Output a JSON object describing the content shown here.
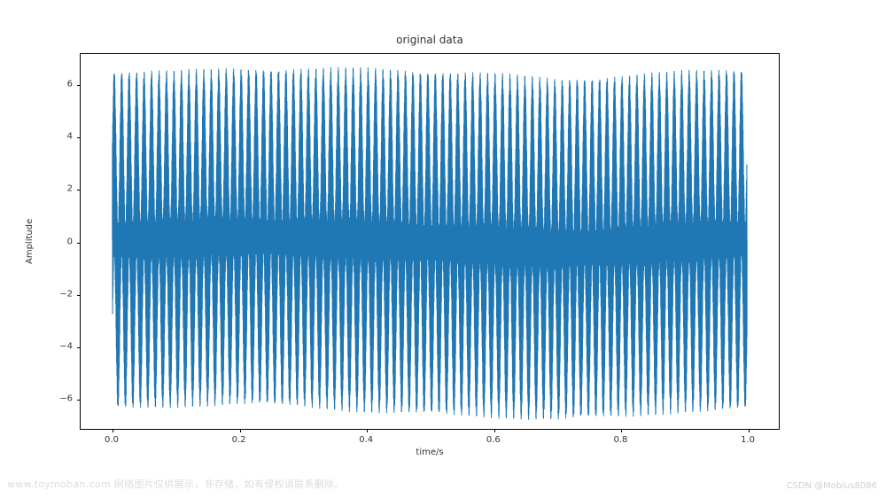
{
  "chart_data": {
    "type": "line",
    "title": "original data",
    "xlabel": "time/s",
    "ylabel": "Amplitude",
    "xticks": [
      0.0,
      0.2,
      0.4,
      0.6,
      0.8,
      1.0
    ],
    "yticks": [
      -6,
      -4,
      -2,
      0,
      2,
      4,
      6
    ],
    "xlim": [
      -0.05,
      1.05
    ],
    "ylim": [
      -7.2,
      7.2
    ],
    "signal": {
      "description": "Densely oscillating multi-frequency waveform filling x ∈ [0,1], positive envelope modulated between about 6.2 and 6.8, negative envelope mirrored between about -6.2 and -6.8. Envelope undulates slowly (≈2 cycles over the interval) with a visible bulge near x≈0.7 on the lower side.",
      "x_start": 0.0,
      "x_end": 1.0,
      "envelope_samples_x": [
        0.0,
        0.1,
        0.2,
        0.3,
        0.4,
        0.5,
        0.6,
        0.7,
        0.8,
        0.9,
        1.0
      ],
      "envelope_upper": [
        6.6,
        6.6,
        6.7,
        6.7,
        6.7,
        6.6,
        6.5,
        6.3,
        6.4,
        6.6,
        6.7
      ],
      "envelope_lower": [
        -6.5,
        -6.4,
        -6.3,
        -6.4,
        -6.6,
        -6.7,
        -6.8,
        -6.9,
        -6.8,
        -6.6,
        -6.5
      ]
    },
    "line_color": "#1f77b4"
  },
  "watermarks": {
    "left": "www.toymoban.com 网络图片仅供展示，非存储，如有侵权请联系删除。",
    "right": "CSDN @Mobius8086"
  }
}
